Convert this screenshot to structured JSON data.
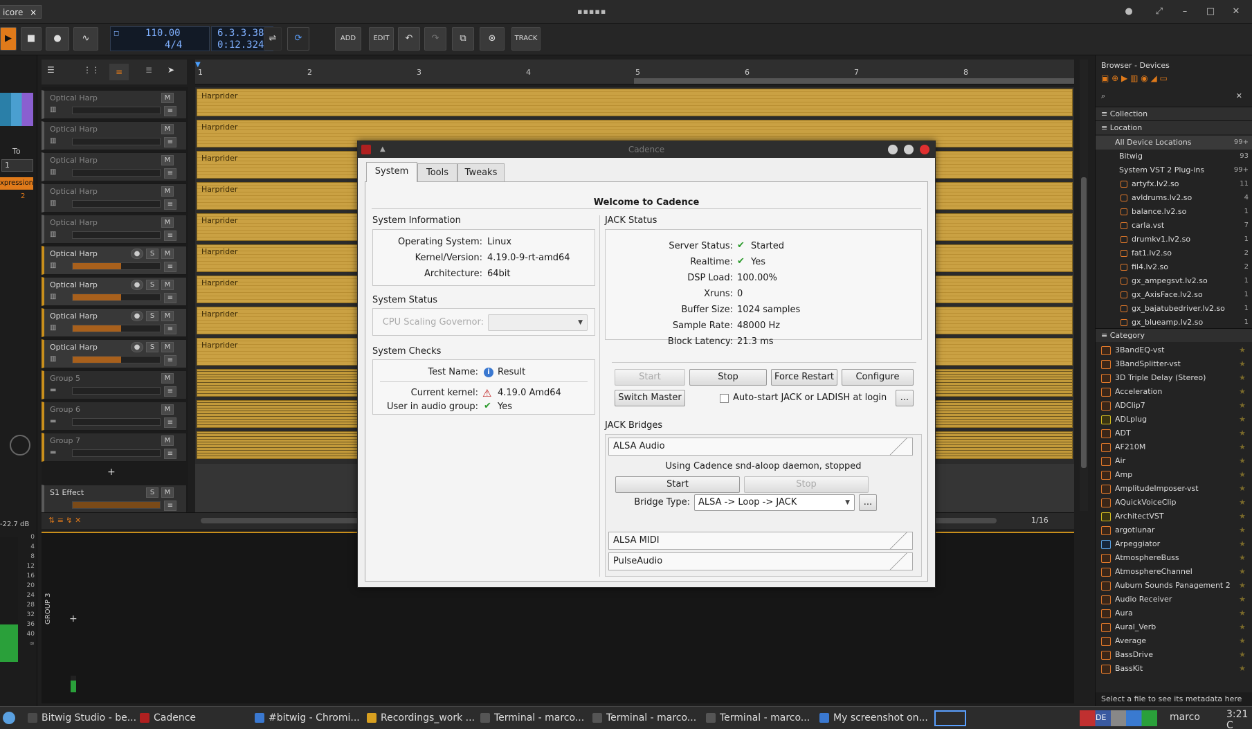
{
  "window": {
    "project_tab": "icore",
    "close_glyph": "×"
  },
  "transport": {
    "tempo": "110.00",
    "signature": "4/4",
    "position_bars": "6.3.3.38",
    "position_time": "0:12.324",
    "add_label": "ADD",
    "edit_label": "EDIT",
    "track_label": "TRACK"
  },
  "left_strip": {
    "to_label": "To",
    "to_value": "1",
    "expression_label": "xpression",
    "expr_value": "2",
    "db_readout": "-22.7 dB",
    "meter_scale": [
      "0",
      "4",
      "8",
      "12",
      "16",
      "20",
      "24",
      "28",
      "32",
      "36",
      "40",
      "∞"
    ]
  },
  "ruler": {
    "marks": [
      "1",
      "2",
      "3",
      "4",
      "5",
      "6",
      "7",
      "8"
    ]
  },
  "tracks": [
    {
      "name": "Optical Harp",
      "clip": "Harprider",
      "active": false
    },
    {
      "name": "Optical Harp",
      "clip": "Harprider",
      "active": false
    },
    {
      "name": "Optical Harp",
      "clip": "Harprider",
      "active": false
    },
    {
      "name": "Optical Harp",
      "clip": "Harprider",
      "active": false
    },
    {
      "name": "Optical Harp",
      "clip": "Harprider",
      "active": false
    },
    {
      "name": "Optical Harp",
      "clip": "Harprider",
      "active": true
    },
    {
      "name": "Optical Harp",
      "clip": "Harprider",
      "active": true
    },
    {
      "name": "Optical Harp",
      "clip": "Harprider",
      "active": true
    },
    {
      "name": "Optical Harp",
      "clip": "Harprider",
      "active": true
    }
  ],
  "groups": [
    "Group 5",
    "Group 6",
    "Group 7"
  ],
  "effect_track": "S1 Effect",
  "btn": {
    "m": "M",
    "s": "S",
    "plus": "+"
  },
  "bottom": {
    "zoom": "1/16",
    "group_label": "GROUP 3"
  },
  "browser": {
    "title": "Browser - Devices",
    "collection": "Collection",
    "location": "Location",
    "locations": [
      {
        "label": "All Device Locations",
        "count": "99+"
      },
      {
        "label": "Bitwig",
        "count": "93"
      },
      {
        "label": "System VST 2 Plug-ins",
        "count": "99+"
      }
    ],
    "files": [
      {
        "label": "artyfx.lv2.so",
        "count": "11"
      },
      {
        "label": "avldrums.lv2.so",
        "count": "4"
      },
      {
        "label": "balance.lv2.so",
        "count": "1"
      },
      {
        "label": "carla.vst",
        "count": "7"
      },
      {
        "label": "drumkv1.lv2.so",
        "count": "1"
      },
      {
        "label": "fat1.lv2.so",
        "count": "2"
      },
      {
        "label": "fil4.lv2.so",
        "count": "2"
      },
      {
        "label": "gx_ampegsvt.lv2.so",
        "count": "1"
      },
      {
        "label": "gx_AxisFace.lv2.so",
        "count": "1"
      },
      {
        "label": "gx_bajatubedriver.lv2.so",
        "count": "1"
      },
      {
        "label": "gx_blueamp.lv2.so",
        "count": "1"
      }
    ],
    "category": "Category",
    "categories": [
      "3BandEQ-vst",
      "3BandSplitter-vst",
      "3D Triple Delay (Stereo)",
      "Acceleration",
      "ADClip7",
      "ADLplug",
      "ADT",
      "AF210M",
      "Air",
      "Amp",
      "AmplitudeImposer-vst",
      "AQuickVoiceClip",
      "ArchitectVST",
      "argotlunar",
      "Arpeggiator",
      "AtmosphereBuss",
      "AtmosphereChannel",
      "Auburn Sounds Panagement 2",
      "Audio Receiver",
      "Aura",
      "Aural_Verb",
      "Average",
      "BassDrive",
      "BassKit"
    ],
    "footer": "Select a file to see its metadata here"
  },
  "cadence": {
    "title": "Cadence",
    "tabs": [
      "System",
      "Tools",
      "Tweaks"
    ],
    "welcome": "Welcome to Cadence",
    "sysinfo_title": "System Information",
    "os_label": "Operating System:",
    "os_value": "Linux",
    "kernel_label": "Kernel/Version:",
    "kernel_value": "4.19.0-9-rt-amd64",
    "arch_label": "Architecture:",
    "arch_value": "64bit",
    "sysstatus_title": "System Status",
    "cpu_label": "CPU Scaling Governor:",
    "checks_title": "System Checks",
    "test_name_label": "Test Name:",
    "test_name_value": "Result",
    "current_kernel_label": "Current kernel:",
    "current_kernel_value": "4.19.0 Amd64",
    "audio_group_label": "User in audio group:",
    "audio_group_value": "Yes",
    "jack_status_title": "JACK Status",
    "server_status_label": "Server Status:",
    "server_status_value": "Started",
    "realtime_label": "Realtime:",
    "realtime_value": "Yes",
    "dsp_label": "DSP Load:",
    "dsp_value": "100.00%",
    "xruns_label": "Xruns:",
    "xruns_value": "0",
    "buffer_label": "Buffer Size:",
    "buffer_value": "1024 samples",
    "rate_label": "Sample Rate:",
    "rate_value": "48000 Hz",
    "latency_label": "Block Latency:",
    "latency_value": "21.3 ms",
    "btn_start": "Start",
    "btn_stop": "Stop",
    "btn_force_restart": "Force Restart",
    "btn_configure": "Configure",
    "btn_switch_master": "Switch Master",
    "autostart_label": "Auto-start JACK or LADISH at login",
    "more": "...",
    "bridges_title": "JACK Bridges",
    "alsa_audio": "ALSA Audio",
    "alsa_audio_status": "Using Cadence snd-aloop daemon, stopped",
    "bridge_type_label": "Bridge Type:",
    "bridge_type_value": "ALSA -> Loop -> JACK",
    "alsa_midi": "ALSA MIDI",
    "pulseaudio": "PulseAudio"
  },
  "taskbar": {
    "tasks": [
      "Bitwig Studio - be...",
      "Cadence",
      "#bitwig - Chromi...",
      "Recordings_work ...",
      "Terminal - marco...",
      "Terminal - marco...",
      "Terminal - marco...",
      "My screenshot on..."
    ],
    "user": "marco",
    "clock": "3:21 C",
    "kbd": "DE"
  }
}
